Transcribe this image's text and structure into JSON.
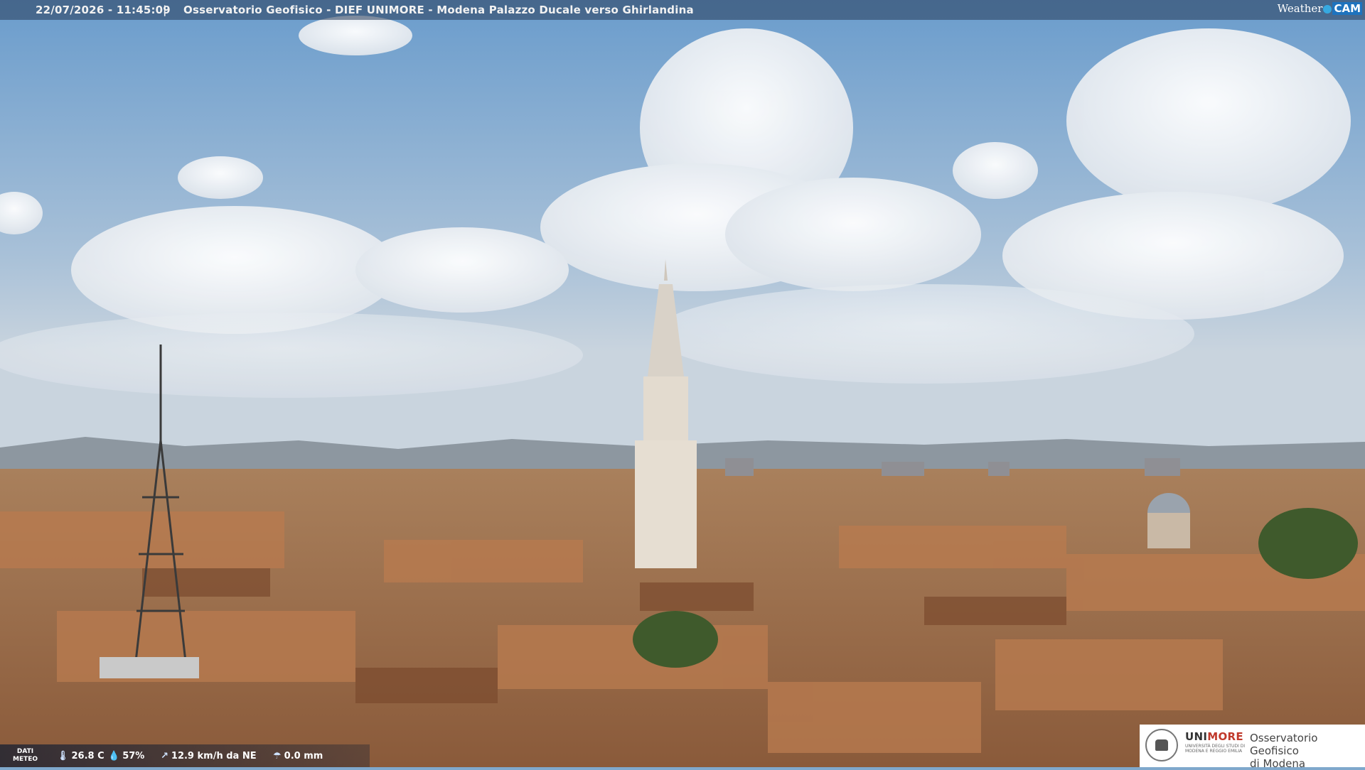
{
  "header": {
    "timestamp": "22/07/2026 - 11:45:09",
    "separator": "|",
    "location": "Osservatorio Geofisico - DIEF UNIMORE - Modena Palazzo Ducale verso Ghirlandina",
    "brand_weather": "Weather",
    "brand_cam": "CAM"
  },
  "weather": {
    "label_line1": "DATI",
    "label_line2": "METEO",
    "temperature": "26.8 C",
    "humidity": "57%",
    "wind": "12.9 km/h da NE",
    "rain": "0.0 mm"
  },
  "logo": {
    "uni_a": "UNI",
    "uni_b": "MORE",
    "uni_sub": "UNIVERSITÀ DEGLI STUDI DI MODENA E REGGIO EMILIA",
    "observatory_line1": "Osservatorio Geofisico",
    "observatory_line2": "di Modena"
  },
  "colors": {
    "sky_top": "#6f9fcc",
    "sky_bottom": "#c9d6e2",
    "roof": "#b06f45",
    "tower": "#e6ded2",
    "brand_blue": "#1e73be",
    "unimore_red": "#c0392b"
  },
  "icons": [
    "thermometer-icon",
    "droplet-icon",
    "wind-icon",
    "rain-icon"
  ]
}
